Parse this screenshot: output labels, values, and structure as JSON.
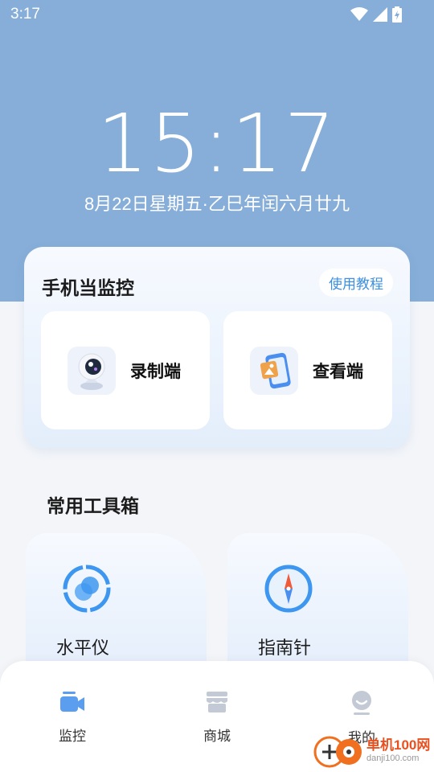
{
  "status_bar": {
    "time": "3:17"
  },
  "clock": {
    "time": "15:17",
    "date": "8月22日星期五·乙巳年闰六月廿九"
  },
  "monitor_card": {
    "title": "手机当监控",
    "tutorial_label": "使用教程",
    "options": [
      {
        "label": "录制端",
        "icon": "camera-icon"
      },
      {
        "label": "查看端",
        "icon": "phone-viewer-icon"
      }
    ]
  },
  "toolbox": {
    "title": "常用工具箱",
    "tools": [
      {
        "label": "水平仪",
        "icon": "level-icon"
      },
      {
        "label": "指南针",
        "icon": "compass-icon"
      }
    ]
  },
  "tabbar": {
    "tabs": [
      {
        "label": "监控",
        "icon": "video-camera-icon"
      },
      {
        "label": "商城",
        "icon": "store-icon"
      },
      {
        "label": "我的",
        "icon": "profile-icon"
      }
    ]
  },
  "watermark": {
    "line1": "单机100网",
    "line2": "danji100.com"
  },
  "colors": {
    "hero_bg": "#86aed8",
    "accent": "#3d8fe0",
    "tab_active": "#5b9ef0"
  }
}
